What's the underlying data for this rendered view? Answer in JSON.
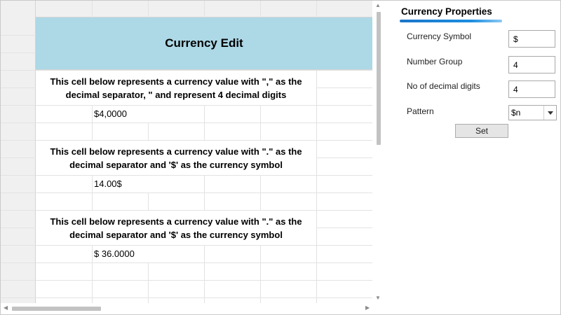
{
  "sheet": {
    "title": "Currency Edit",
    "blocks": [
      {
        "description": "This cell below represents a currency value with \",\" as the decimal separator, \" and represent 4 decimal digits",
        "value": "$4,0000"
      },
      {
        "description": "This cell below represents a currency value with \".\" as the decimal separator and '$' as the currency symbol",
        "value": "14.00$"
      },
      {
        "description": "This cell below represents a currency value with \".\" as the decimal separator and '$' as the currency symbol",
        "value": "$ 36.0000"
      }
    ],
    "title_bg_color": "#add8e6"
  },
  "panel": {
    "title": "Currency Properties",
    "fields": [
      {
        "label": "Currency Symbol",
        "value": "$"
      },
      {
        "label": "Number Group",
        "value": "4"
      },
      {
        "label": "No of decimal digits",
        "value": "4"
      }
    ],
    "pattern": {
      "label": "Pattern",
      "selected": "$n"
    },
    "set_label": "Set",
    "accent_color": "#1b75c9"
  }
}
